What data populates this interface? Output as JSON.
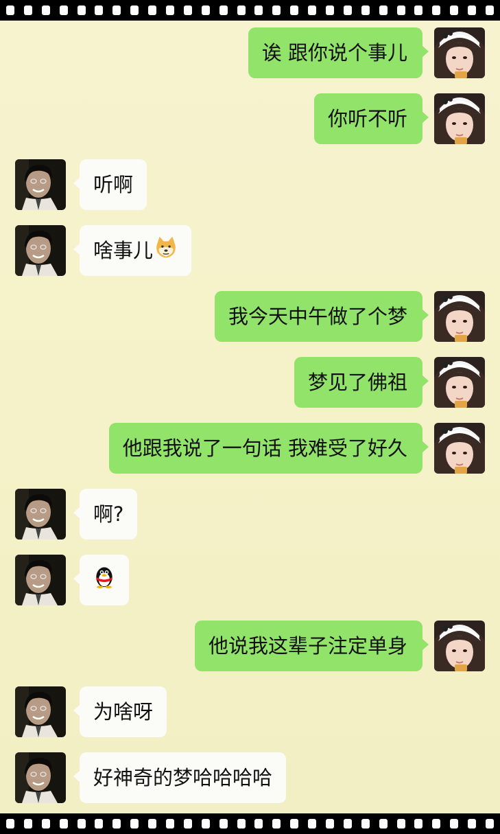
{
  "chat": {
    "messages": [
      {
        "sender": "me",
        "text": "诶 跟你说个事儿"
      },
      {
        "sender": "me",
        "text": "你听不听"
      },
      {
        "sender": "them",
        "text": "听啊"
      },
      {
        "sender": "them",
        "text": "啥事儿",
        "emoji": "doge-face-icon"
      },
      {
        "sender": "me",
        "text": "我今天中午做了个梦"
      },
      {
        "sender": "me",
        "text": "梦见了佛祖"
      },
      {
        "sender": "me",
        "text": "他跟我说了一句话 我难受了好久"
      },
      {
        "sender": "them",
        "text": "啊?"
      },
      {
        "sender": "them",
        "text": "",
        "emoji": "penguin-icon"
      },
      {
        "sender": "me",
        "text": "他说我这辈子注定单身"
      },
      {
        "sender": "them",
        "text": "为啥呀"
      },
      {
        "sender": "them",
        "text": "好神奇的梦哈哈哈哈"
      }
    ]
  },
  "colors": {
    "background": "#f4f1c6",
    "sent_bubble": "#91e36a",
    "received_bubble": "#fbfbf7",
    "film_strip": "#000000"
  }
}
